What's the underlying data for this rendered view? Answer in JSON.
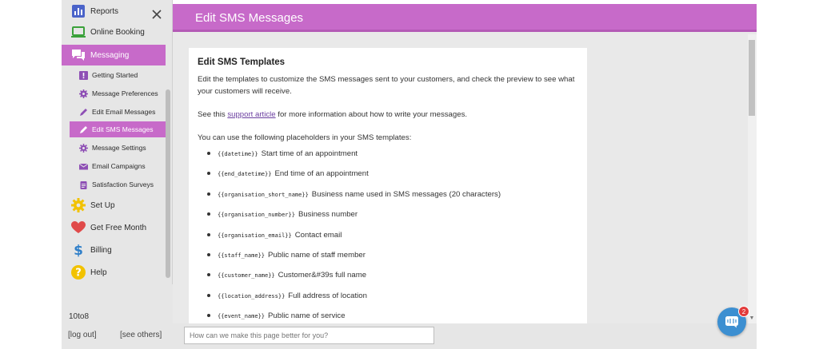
{
  "sidebar": {
    "items": [
      {
        "label": "Reports",
        "icon": "bar-chart-icon"
      },
      {
        "label": "Online Booking",
        "icon": "laptop-icon"
      },
      {
        "label": "Messaging",
        "icon": "chat-icon"
      },
      {
        "label": "Getting Started",
        "icon": "alert-icon"
      },
      {
        "label": "Message Preferences",
        "icon": "gear-icon"
      },
      {
        "label": "Edit Email Messages",
        "icon": "pencil-icon"
      },
      {
        "label": "Edit SMS Messages",
        "icon": "pencil-icon"
      },
      {
        "label": "Message Settings",
        "icon": "gear-icon"
      },
      {
        "label": "Email Campaigns",
        "icon": "envelope-icon"
      },
      {
        "label": "Satisfaction Surveys",
        "icon": "clipboard-icon"
      },
      {
        "label": "Set Up",
        "icon": "gear-icon"
      },
      {
        "label": "Get Free Month",
        "icon": "heart-icon"
      },
      {
        "label": "Billing",
        "icon": "dollar-icon"
      },
      {
        "label": "Help",
        "icon": "question-icon"
      }
    ],
    "active_item": "Edit SMS Messages",
    "org_name": "10to8",
    "logout_label": "[log out]",
    "see_others_label": "[see others]"
  },
  "header": {
    "title": "Edit SMS Messages"
  },
  "card": {
    "heading": "Edit SMS Templates",
    "intro": "Edit the templates to customize the SMS messages sent to your customers, and check the preview to see what your customers will receive.",
    "see_prefix": "See this ",
    "support_link": "support article",
    "see_suffix": " for more information about how to write your messages.",
    "placeholders_intro": "You can use the following placeholders in your SMS templates:",
    "placeholders": [
      {
        "code": "{{datetime}}",
        "desc": "Start time of an appointment"
      },
      {
        "code": "{{end_datetime}}",
        "desc": "End time of an appointment"
      },
      {
        "code": "{{organisation_short_name}}",
        "desc": "Business name used in SMS messages (20 characters)"
      },
      {
        "code": "{{organisation_number}}",
        "desc": "Business number"
      },
      {
        "code": "{{organisation_email}}",
        "desc": "Contact email"
      },
      {
        "code": "{{staff_name}}",
        "desc": "Public name of staff member"
      },
      {
        "code": "{{customer_name}}",
        "desc": "Customer&#39s full name"
      },
      {
        "code": "{{location_address}}",
        "desc": "Full address of location"
      },
      {
        "code": "{{event_name}}",
        "desc": "Public name of service"
      }
    ]
  },
  "feedback": {
    "placeholder": "How can we make this page better for you?"
  },
  "chat": {
    "badge_count": "2"
  },
  "colors": {
    "accent": "#c76ac9",
    "chat": "#3c8fd1",
    "badge": "#e23b3b"
  }
}
